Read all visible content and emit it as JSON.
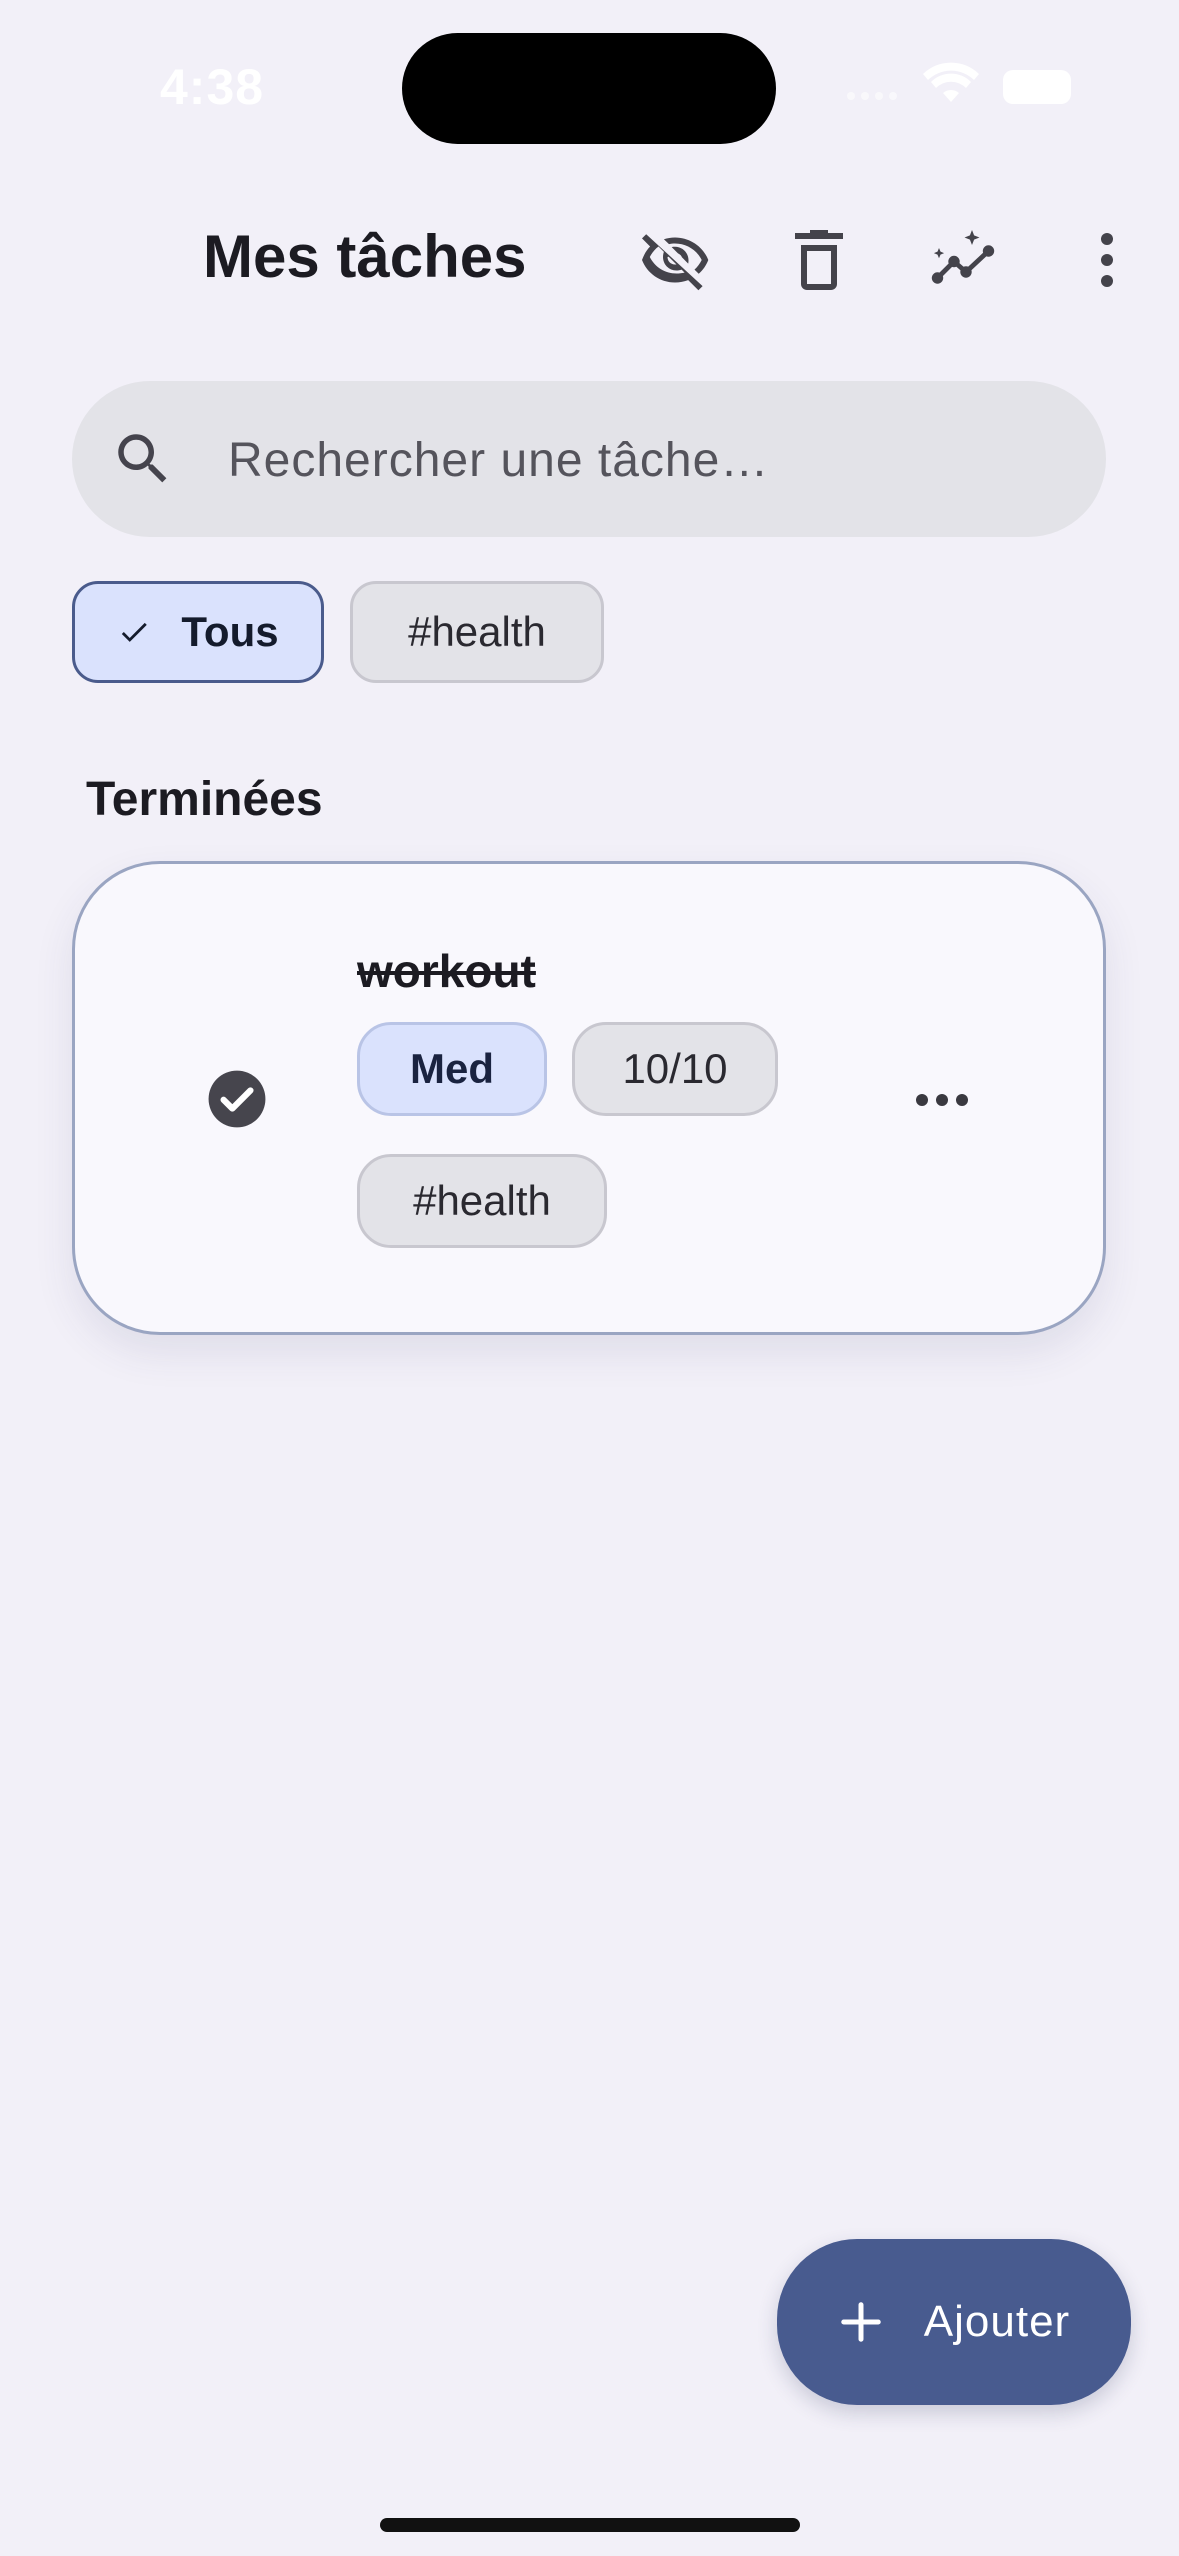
{
  "status_bar": {
    "time": "4:38"
  },
  "header": {
    "title": "Mes tâches",
    "actions": [
      "hide-completed-icon",
      "delete-icon",
      "stats-icon",
      "more-vert-icon"
    ]
  },
  "search": {
    "placeholder": "Rechercher une tâche…",
    "value": ""
  },
  "filters": [
    {
      "label": "Tous",
      "selected": true
    },
    {
      "label": "#health",
      "selected": false
    }
  ],
  "section_title": "Terminées",
  "tasks": [
    {
      "title": "workout",
      "completed": true,
      "priority": "Med",
      "score": "10/10",
      "tags": [
        "#health"
      ]
    }
  ],
  "fab": {
    "label": "Ajouter"
  },
  "colors": {
    "background": "#f2f0f8",
    "accent": "#485b8f",
    "chip_selected": "#dae2fd",
    "chip_neutral": "#e3e3e8"
  }
}
